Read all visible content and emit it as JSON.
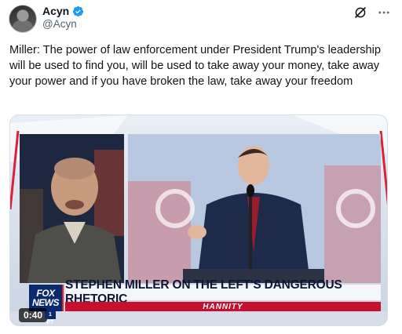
{
  "author": {
    "display_name": "Acyn",
    "handle": "@Acyn",
    "verified_color": "#1d9bf0"
  },
  "actions": {
    "grok_icon": "grok-icon",
    "more_icon": "more-icon"
  },
  "tweet": {
    "text": "Miller: The power of law enforcement under President Trump's leadership will be used to find you, will be used to take away your money, take away your power and if you have broken the law, take away your freedom"
  },
  "video": {
    "network": "FOX NEWS",
    "network_line1": "FOX",
    "network_line2": "NEWS",
    "headline": "STEPHEN MILLER ON THE LEFT'S DANGEROUS RHETORIC",
    "show": "HANNITY",
    "time_code": "0:40",
    "time_zone_badge": "1 PT",
    "brand_colors": {
      "fox_blue": "#0a2a6e",
      "alert_red": "#c8102e"
    }
  }
}
